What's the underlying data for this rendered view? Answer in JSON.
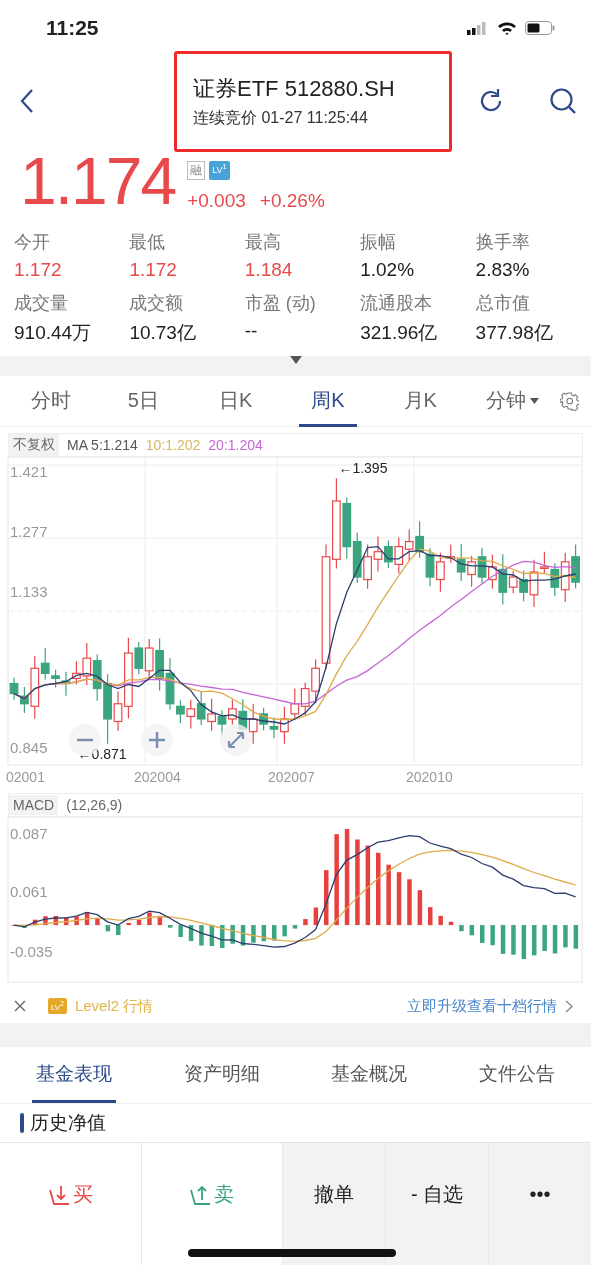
{
  "status_bar": {
    "time": "11:25"
  },
  "header": {
    "title": "证券ETF 512880.SH",
    "subtitle": "连续竞价 01-27 11:25:44",
    "highlighted": true
  },
  "quote": {
    "price": "1.174",
    "change": "+0.003",
    "change_pct": "+0.26%",
    "margin_badge": "融",
    "level_badge": "LV$^{1}$"
  },
  "stats": [
    {
      "label": "今开",
      "value": "1.172",
      "color": "#e8494b"
    },
    {
      "label": "最低",
      "value": "1.172",
      "color": "#e8494b"
    },
    {
      "label": "最高",
      "value": "1.184",
      "color": "#e8494b"
    },
    {
      "label": "振幅",
      "value": "1.02%",
      "color": "#222222"
    },
    {
      "label": "换手率",
      "value": "2.83%",
      "color": "#222222"
    },
    {
      "label": "成交量",
      "value": "910.44万",
      "color": "#222222"
    },
    {
      "label": "成交额",
      "value": "10.73亿",
      "color": "#222222"
    },
    {
      "label": "市盈 (动)",
      "value": "--",
      "color": "#222222"
    },
    {
      "label": "流通股本",
      "value": "321.96亿",
      "color": "#222222"
    },
    {
      "label": "总市值",
      "value": "377.98亿",
      "color": "#222222"
    }
  ],
  "chart_tabs": [
    {
      "label": "分时",
      "selected": false,
      "kind": "plain"
    },
    {
      "label": "5日",
      "selected": false,
      "kind": "plain"
    },
    {
      "label": "日K",
      "selected": false,
      "kind": "plain"
    },
    {
      "label": "周K",
      "selected": true,
      "kind": "plain"
    },
    {
      "label": "月K",
      "selected": false,
      "kind": "plain"
    },
    {
      "label": "分钟",
      "selected": false,
      "kind": "dropdown"
    }
  ],
  "kline": {
    "adjust": "不复权",
    "ma5": "MA 5:1.214",
    "ma10": "10:1.202",
    "ma20": "20:1.204",
    "y_labels": [
      "1.421",
      "1.277",
      "1.133",
      "0.845"
    ],
    "x_labels": [
      "02001",
      "202004",
      "202007",
      "202010"
    ],
    "high_marker": "←1.395",
    "low_marker": "←0.871"
  },
  "macd": {
    "label": "MACD",
    "params": "(12,26,9)",
    "y_labels": [
      "0.087",
      "0.061",
      "-0.035"
    ]
  },
  "level2": {
    "badge": "LV$^{2}$",
    "text": "Level2 行情",
    "link": "立即升级查看十档行情"
  },
  "fund_tabs": [
    {
      "label": "基金表现",
      "selected": true
    },
    {
      "label": "资产明细",
      "selected": false
    },
    {
      "label": "基金概况",
      "selected": false
    },
    {
      "label": "文件公告",
      "selected": false
    }
  ],
  "section_title": "历史净值",
  "actions": [
    {
      "label": "买",
      "kind": "buy"
    },
    {
      "label": "卖",
      "kind": "sell"
    },
    {
      "label": "撤单",
      "kind": "plain"
    },
    {
      "label": "- 自选",
      "kind": "plain"
    },
    {
      "label": "•••",
      "kind": "plain"
    }
  ]
}
